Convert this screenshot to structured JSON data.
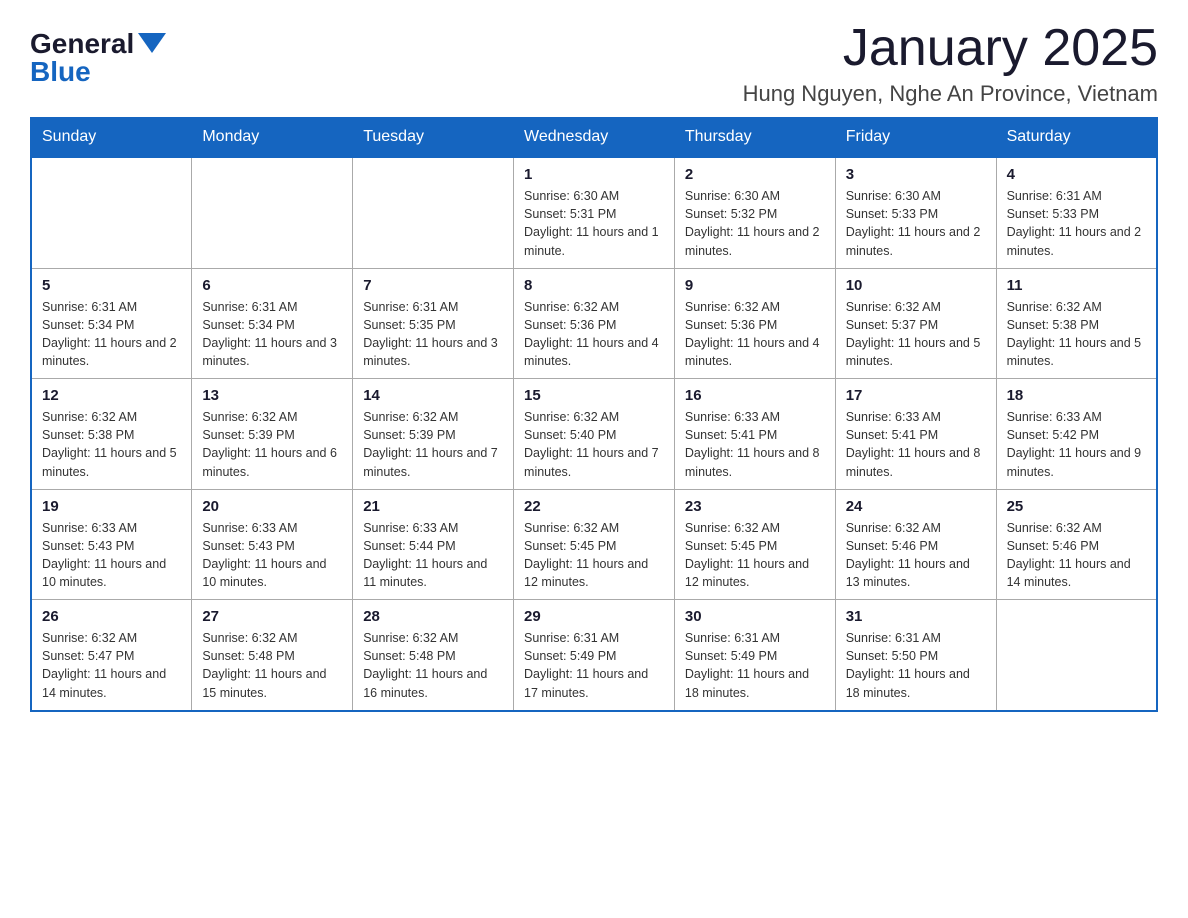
{
  "header": {
    "logo_general": "General",
    "logo_blue": "Blue",
    "month_title": "January 2025",
    "location": "Hung Nguyen, Nghe An Province, Vietnam"
  },
  "days_of_week": [
    "Sunday",
    "Monday",
    "Tuesday",
    "Wednesday",
    "Thursday",
    "Friday",
    "Saturday"
  ],
  "weeks": [
    [
      {
        "day": "",
        "info": ""
      },
      {
        "day": "",
        "info": ""
      },
      {
        "day": "",
        "info": ""
      },
      {
        "day": "1",
        "info": "Sunrise: 6:30 AM\nSunset: 5:31 PM\nDaylight: 11 hours and 1 minute."
      },
      {
        "day": "2",
        "info": "Sunrise: 6:30 AM\nSunset: 5:32 PM\nDaylight: 11 hours and 2 minutes."
      },
      {
        "day": "3",
        "info": "Sunrise: 6:30 AM\nSunset: 5:33 PM\nDaylight: 11 hours and 2 minutes."
      },
      {
        "day": "4",
        "info": "Sunrise: 6:31 AM\nSunset: 5:33 PM\nDaylight: 11 hours and 2 minutes."
      }
    ],
    [
      {
        "day": "5",
        "info": "Sunrise: 6:31 AM\nSunset: 5:34 PM\nDaylight: 11 hours and 2 minutes."
      },
      {
        "day": "6",
        "info": "Sunrise: 6:31 AM\nSunset: 5:34 PM\nDaylight: 11 hours and 3 minutes."
      },
      {
        "day": "7",
        "info": "Sunrise: 6:31 AM\nSunset: 5:35 PM\nDaylight: 11 hours and 3 minutes."
      },
      {
        "day": "8",
        "info": "Sunrise: 6:32 AM\nSunset: 5:36 PM\nDaylight: 11 hours and 4 minutes."
      },
      {
        "day": "9",
        "info": "Sunrise: 6:32 AM\nSunset: 5:36 PM\nDaylight: 11 hours and 4 minutes."
      },
      {
        "day": "10",
        "info": "Sunrise: 6:32 AM\nSunset: 5:37 PM\nDaylight: 11 hours and 5 minutes."
      },
      {
        "day": "11",
        "info": "Sunrise: 6:32 AM\nSunset: 5:38 PM\nDaylight: 11 hours and 5 minutes."
      }
    ],
    [
      {
        "day": "12",
        "info": "Sunrise: 6:32 AM\nSunset: 5:38 PM\nDaylight: 11 hours and 5 minutes."
      },
      {
        "day": "13",
        "info": "Sunrise: 6:32 AM\nSunset: 5:39 PM\nDaylight: 11 hours and 6 minutes."
      },
      {
        "day": "14",
        "info": "Sunrise: 6:32 AM\nSunset: 5:39 PM\nDaylight: 11 hours and 7 minutes."
      },
      {
        "day": "15",
        "info": "Sunrise: 6:32 AM\nSunset: 5:40 PM\nDaylight: 11 hours and 7 minutes."
      },
      {
        "day": "16",
        "info": "Sunrise: 6:33 AM\nSunset: 5:41 PM\nDaylight: 11 hours and 8 minutes."
      },
      {
        "day": "17",
        "info": "Sunrise: 6:33 AM\nSunset: 5:41 PM\nDaylight: 11 hours and 8 minutes."
      },
      {
        "day": "18",
        "info": "Sunrise: 6:33 AM\nSunset: 5:42 PM\nDaylight: 11 hours and 9 minutes."
      }
    ],
    [
      {
        "day": "19",
        "info": "Sunrise: 6:33 AM\nSunset: 5:43 PM\nDaylight: 11 hours and 10 minutes."
      },
      {
        "day": "20",
        "info": "Sunrise: 6:33 AM\nSunset: 5:43 PM\nDaylight: 11 hours and 10 minutes."
      },
      {
        "day": "21",
        "info": "Sunrise: 6:33 AM\nSunset: 5:44 PM\nDaylight: 11 hours and 11 minutes."
      },
      {
        "day": "22",
        "info": "Sunrise: 6:32 AM\nSunset: 5:45 PM\nDaylight: 11 hours and 12 minutes."
      },
      {
        "day": "23",
        "info": "Sunrise: 6:32 AM\nSunset: 5:45 PM\nDaylight: 11 hours and 12 minutes."
      },
      {
        "day": "24",
        "info": "Sunrise: 6:32 AM\nSunset: 5:46 PM\nDaylight: 11 hours and 13 minutes."
      },
      {
        "day": "25",
        "info": "Sunrise: 6:32 AM\nSunset: 5:46 PM\nDaylight: 11 hours and 14 minutes."
      }
    ],
    [
      {
        "day": "26",
        "info": "Sunrise: 6:32 AM\nSunset: 5:47 PM\nDaylight: 11 hours and 14 minutes."
      },
      {
        "day": "27",
        "info": "Sunrise: 6:32 AM\nSunset: 5:48 PM\nDaylight: 11 hours and 15 minutes."
      },
      {
        "day": "28",
        "info": "Sunrise: 6:32 AM\nSunset: 5:48 PM\nDaylight: 11 hours and 16 minutes."
      },
      {
        "day": "29",
        "info": "Sunrise: 6:31 AM\nSunset: 5:49 PM\nDaylight: 11 hours and 17 minutes."
      },
      {
        "day": "30",
        "info": "Sunrise: 6:31 AM\nSunset: 5:49 PM\nDaylight: 11 hours and 18 minutes."
      },
      {
        "day": "31",
        "info": "Sunrise: 6:31 AM\nSunset: 5:50 PM\nDaylight: 11 hours and 18 minutes."
      },
      {
        "day": "",
        "info": ""
      }
    ]
  ]
}
